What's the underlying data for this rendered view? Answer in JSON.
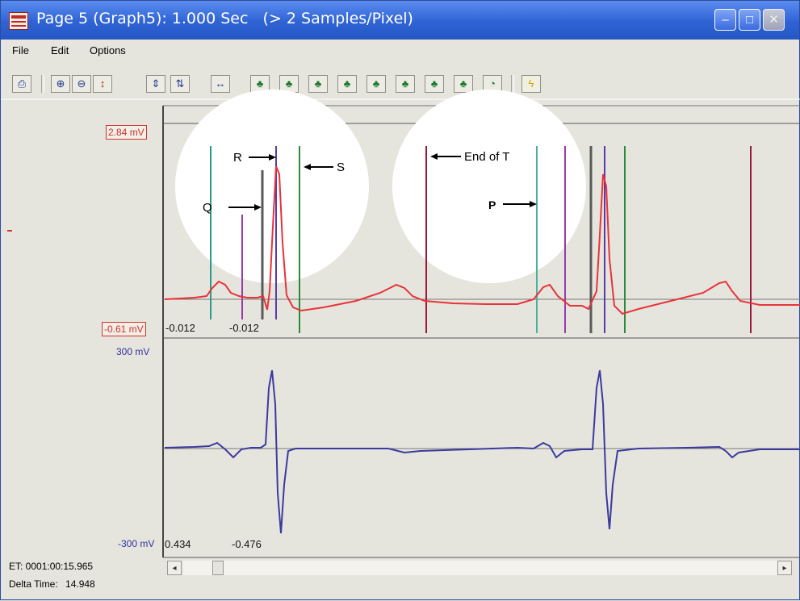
{
  "window": {
    "title": "Page 5 (Graph5): 1.000 Sec   (> 2 Samples/Pixel)",
    "minimize_label": "–",
    "maximize_label": "□",
    "close_label": "✕"
  },
  "menu": {
    "items": [
      {
        "label": "File",
        "accel": "F"
      },
      {
        "label": "Edit",
        "accel": "E"
      },
      {
        "label": "Options",
        "accel": "O"
      }
    ]
  },
  "toolbar": {
    "buttons": [
      {
        "icon": "print-icon",
        "glyph": "⎙"
      },
      {
        "icon": "zoom-in-icon",
        "glyph": "⊕"
      },
      {
        "icon": "zoom-out-icon",
        "glyph": "⊖"
      },
      {
        "icon": "autoscale-icon",
        "glyph": "↕"
      },
      {
        "icon": "expand-vertical-icon",
        "glyph": "⇕"
      },
      {
        "icon": "compress-vertical-icon",
        "glyph": "⇅"
      },
      {
        "icon": "expand-horizontal-icon",
        "glyph": "↔"
      },
      {
        "icon": "marker-1-icon",
        "glyph": "♣"
      },
      {
        "icon": "marker-2-icon",
        "glyph": "♣"
      },
      {
        "icon": "marker-3-icon",
        "glyph": "♣"
      },
      {
        "icon": "marker-4-icon",
        "glyph": "♣"
      },
      {
        "icon": "marker-5-icon",
        "glyph": "♣"
      },
      {
        "icon": "marker-6-icon",
        "glyph": "♣"
      },
      {
        "icon": "marker-7-icon",
        "glyph": "♣"
      },
      {
        "icon": "marker-8-icon",
        "glyph": "♣"
      },
      {
        "icon": "marker-clock-icon",
        "glyph": "◔"
      },
      {
        "icon": "lightning-icon",
        "glyph": "ϟ"
      }
    ]
  },
  "top_channel": {
    "max_label": "2.84 mV",
    "min_label": "-0.61 mV",
    "cursor_values": [
      "-0.012",
      "-0.012"
    ],
    "trace_color": "#e8333a"
  },
  "bottom_channel": {
    "max_label": "300 mV",
    "min_label": "-300 mV",
    "cursor_values": [
      "0.434",
      "-0.476"
    ],
    "trace_color": "#3a3aa0"
  },
  "annotations": {
    "r": "R",
    "s": "S",
    "q": "Q",
    "end_of_t": "End of T",
    "p": "P"
  },
  "status": {
    "et": "ET: 0001:00:15.965",
    "delta_label": "Delta Time:",
    "delta_value": "14.948"
  },
  "colors": {
    "marker_teal": "#2a9a8a",
    "marker_purple": "#9a3aa8",
    "marker_gray": "#5a5a5a",
    "marker_green": "#2a8a3a",
    "marker_maroon": "#9a1a3a"
  }
}
